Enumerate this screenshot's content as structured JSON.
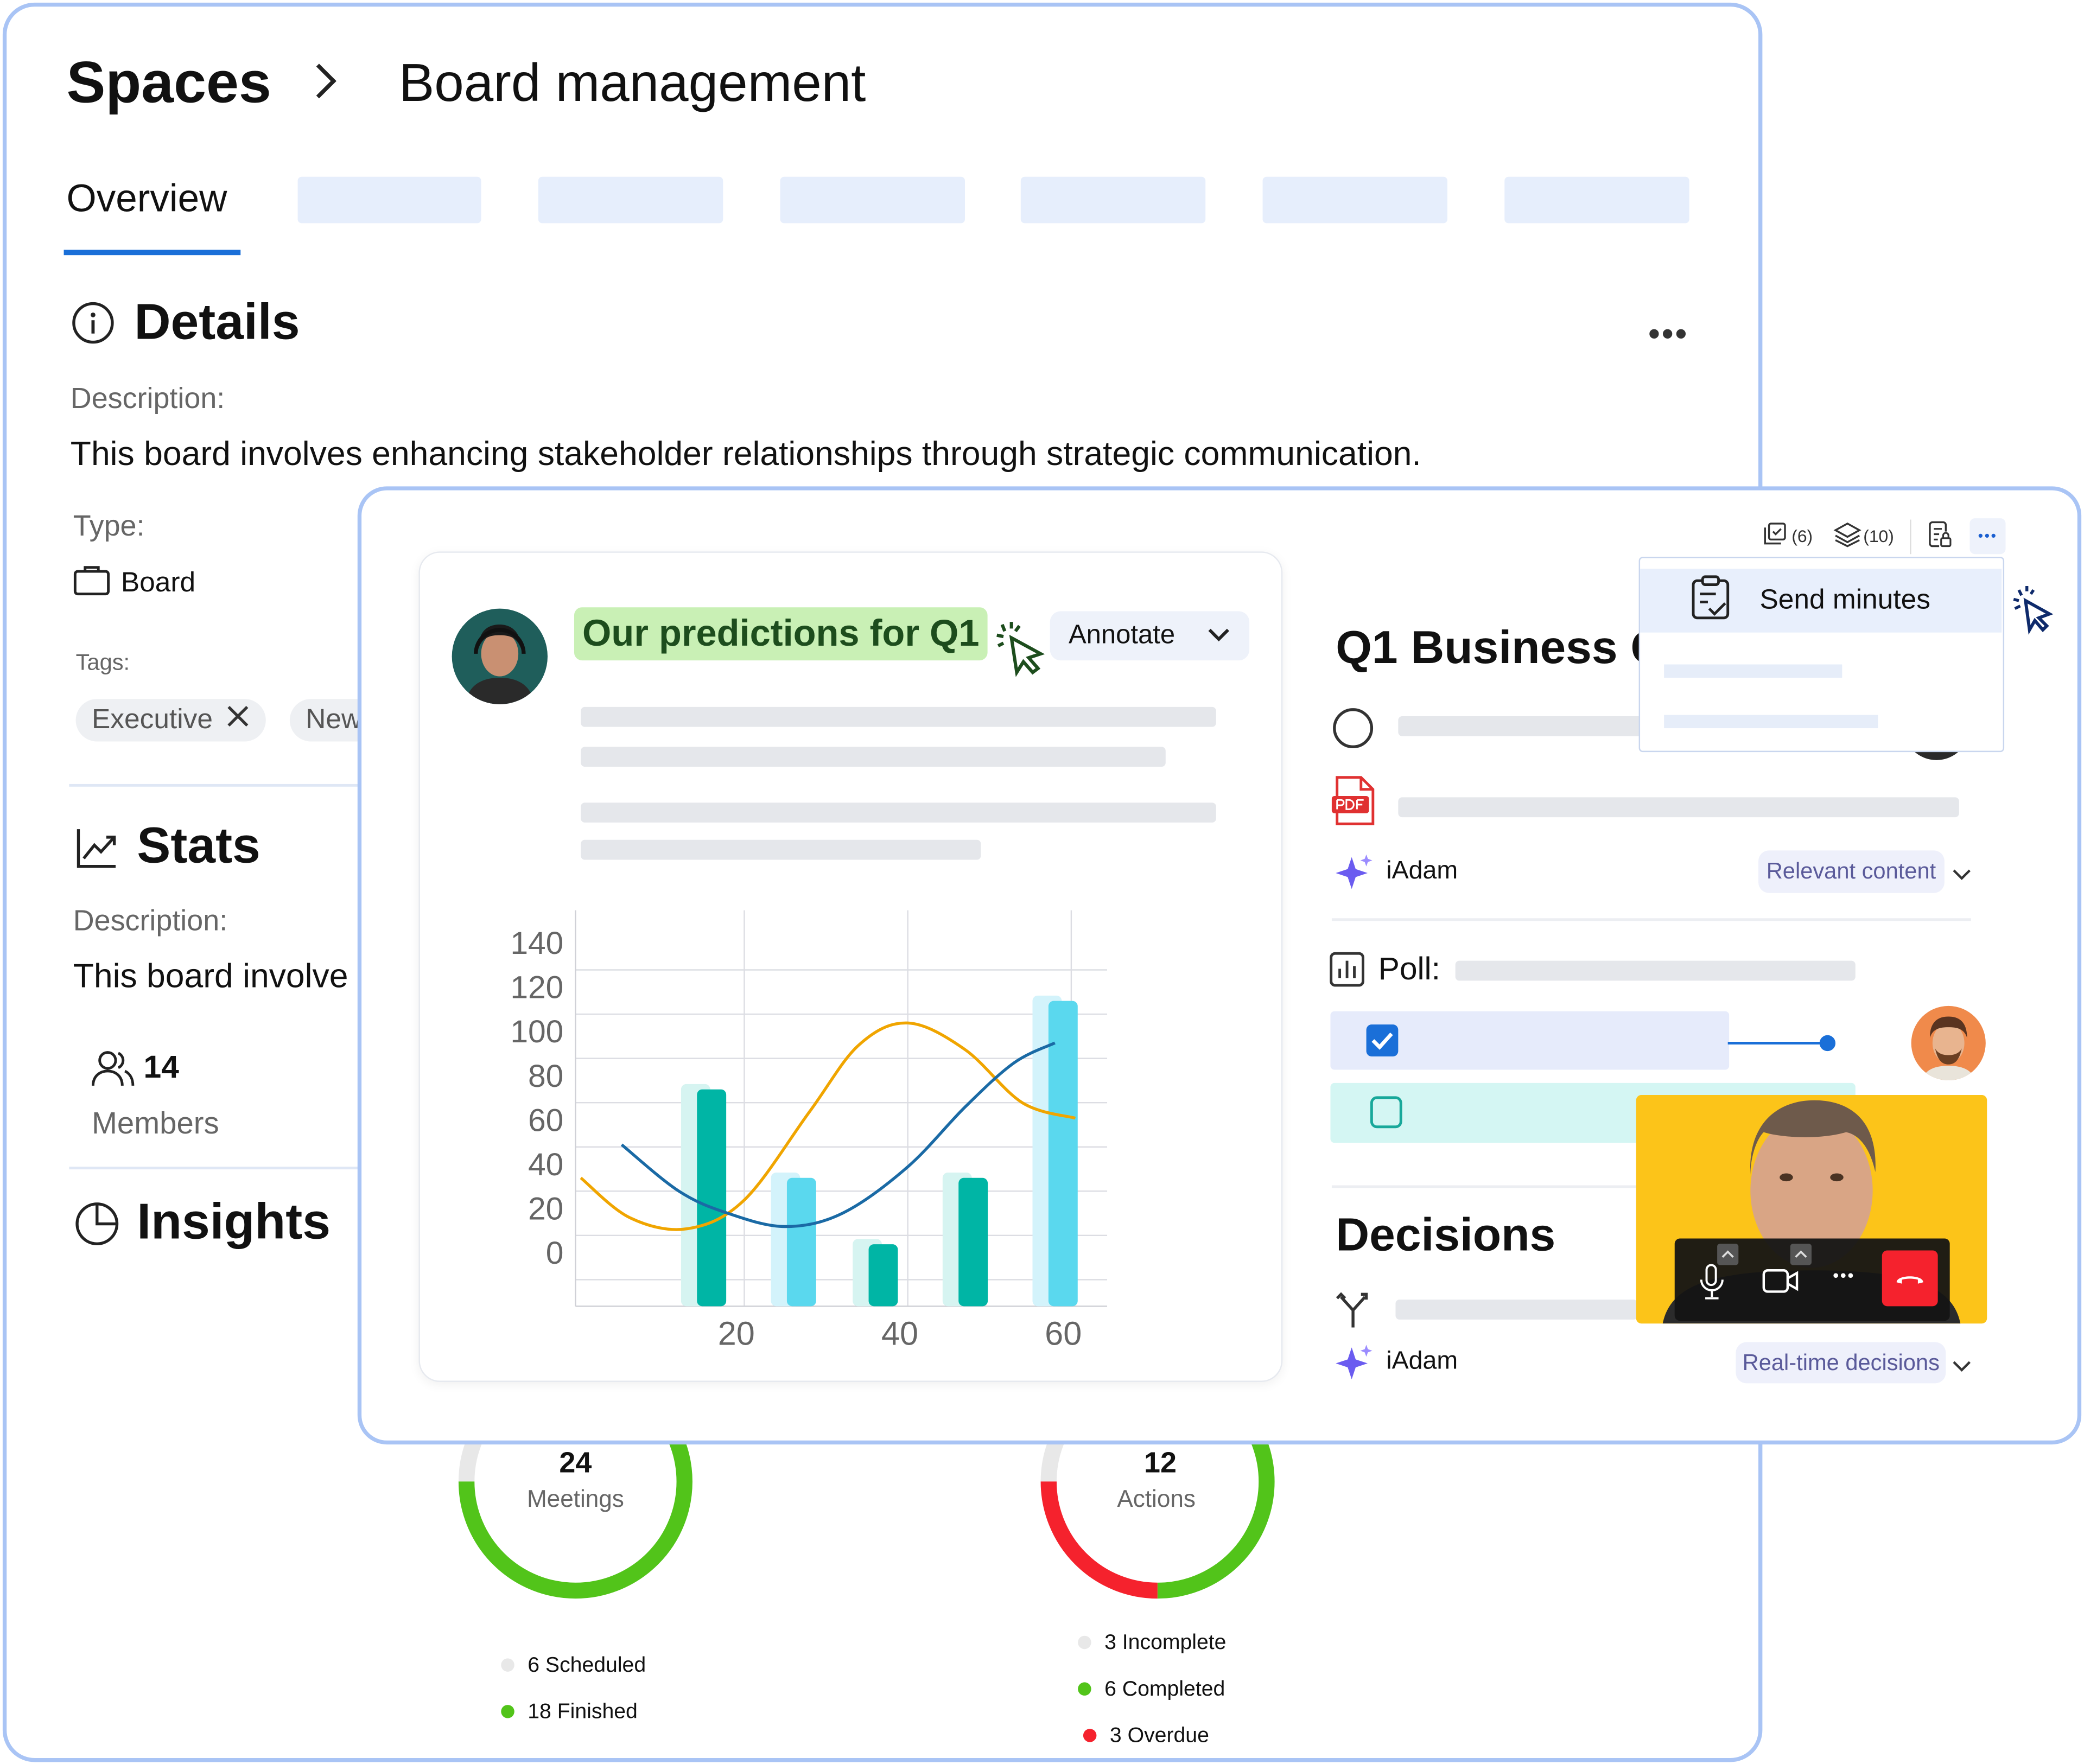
{
  "breadcrumb": {
    "root": "Spaces",
    "current": "Board management"
  },
  "tabs": [
    {
      "label": "Overview",
      "active": true
    }
  ],
  "details": {
    "title": "Details",
    "description_label": "Description:",
    "description": "This board involves enhancing stakeholder relationships through strategic communication.",
    "type_label": "Type:",
    "type_value": "Board",
    "tags_label": "Tags:",
    "tags": [
      "Executive",
      "New"
    ]
  },
  "stats": {
    "title": "Stats",
    "description_label": "Description:",
    "description": "This board involve",
    "members_count": "14",
    "members_label": "Members"
  },
  "insights": {
    "title": "Insights",
    "meetings": {
      "count": "24",
      "label": "Meetings",
      "legend": [
        {
          "text": "6 Scheduled",
          "value": 6,
          "color": "#e8e8e8"
        },
        {
          "text": "18 Finished",
          "value": 18,
          "color": "#52c41a"
        }
      ]
    },
    "actions": {
      "count": "12",
      "label": "Actions",
      "legend": [
        {
          "text": "3 Incomplete",
          "value": 3,
          "color": "#e8e8e8"
        },
        {
          "text": "6 Completed",
          "value": 6,
          "color": "#52c41a"
        },
        {
          "text": "3 Overdue",
          "value": 3,
          "color": "#f5222d"
        }
      ]
    }
  },
  "card": {
    "title": "Our predictions for Q1",
    "annotate_label": "Annotate"
  },
  "chart_data": {
    "type": "bar",
    "xlim": [
      0,
      64
    ],
    "ylim": [
      -18,
      160
    ],
    "x_ticks": [
      20,
      40,
      60
    ],
    "y_ticks": [
      0,
      20,
      40,
      60,
      80,
      100,
      120,
      140
    ],
    "grid": true,
    "bars": [
      {
        "x": 16,
        "value": 80,
        "color": "#00b5a5"
      },
      {
        "x": 27,
        "value": 40,
        "color": "#5ad8ee"
      },
      {
        "x": 37,
        "value": 10,
        "color": "#00b5a5"
      },
      {
        "x": 48,
        "value": 40,
        "color": "#00b5a5"
      },
      {
        "x": 59,
        "value": 120,
        "color": "#5ad8ee"
      }
    ],
    "lines": [
      {
        "color": "#f0a500",
        "points": [
          [
            0,
            40
          ],
          [
            6,
            22
          ],
          [
            13,
            17
          ],
          [
            20,
            30
          ],
          [
            28,
            70
          ],
          [
            34,
            100
          ],
          [
            40,
            110
          ],
          [
            47,
            98
          ],
          [
            54,
            74
          ],
          [
            60.5,
            67
          ]
        ]
      },
      {
        "color": "#1a6aa5",
        "points": [
          [
            5,
            55
          ],
          [
            12,
            34
          ],
          [
            18,
            24
          ],
          [
            25,
            18
          ],
          [
            32,
            24
          ],
          [
            40,
            45
          ],
          [
            47,
            72
          ],
          [
            53,
            92
          ],
          [
            58,
            101
          ]
        ]
      }
    ]
  },
  "toolbar": {
    "tasks_count": "(6)",
    "layers_count": "(10)"
  },
  "menu": {
    "items": [
      "Send minutes"
    ]
  },
  "agenda": {
    "title": "Q1 Business G",
    "iadam_label": "iAdam",
    "relevant_chip": "Relevant content",
    "poll_label": "Poll:",
    "decisions_title": "Decisions",
    "decisions_chip": "Real-time decisions",
    "poll_option1_checked": true,
    "poll_option2_checked": false
  },
  "colors": {
    "accent": "#1a6fd8",
    "border": "#a9c4f5",
    "green": "#52c41a",
    "red": "#f5222d",
    "title_pill": "#c9f0b5",
    "video_bg": "#fcc419"
  }
}
